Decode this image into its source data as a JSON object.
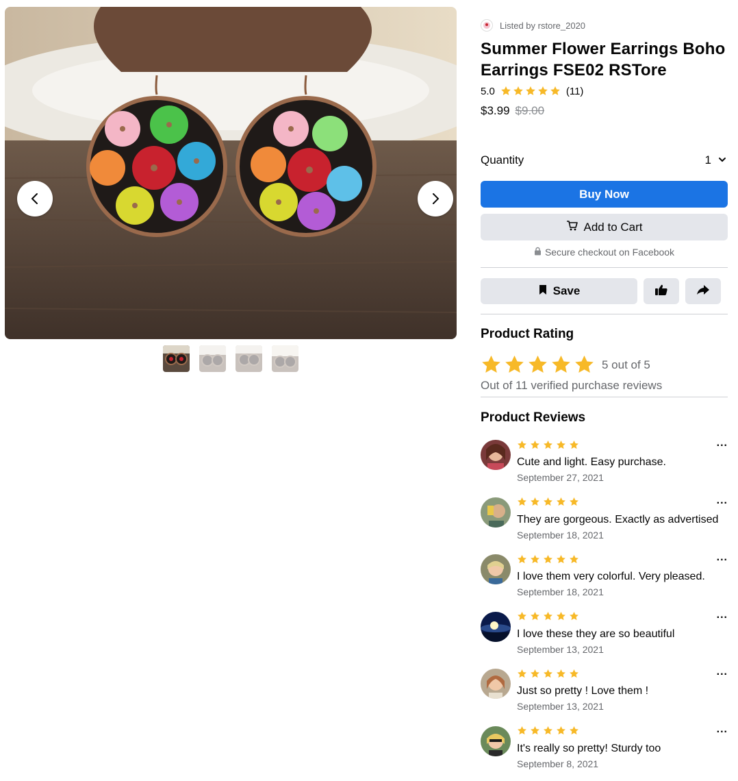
{
  "listing": {
    "seller_text": "Listed by rstore_2020",
    "title": "Summer Flower Earrings Boho Earrings FSE02 RSTore",
    "rating_value": "5.0",
    "rating_count": "(11)",
    "price": "$3.99",
    "original_price": "$9.00"
  },
  "purchase": {
    "quantity_label": "Quantity",
    "quantity_value": "1",
    "buy_label": "Buy Now",
    "cart_label": "Add to Cart",
    "secure_text": "Secure checkout on Facebook",
    "save_label": "Save"
  },
  "product_rating": {
    "heading": "Product Rating",
    "score_text": "5 out of 5",
    "verified_text": "Out of 11 verified purchase reviews",
    "stars": 5
  },
  "reviews_section": {
    "heading": "Product Reviews",
    "items": [
      {
        "text": "Cute and light. Easy purchase.",
        "date": "September 27, 2021",
        "stars": 5,
        "more": "..."
      },
      {
        "text": "They are gorgeous. Exactly as advertised",
        "date": "September 18, 2021",
        "stars": 5,
        "more": "..."
      },
      {
        "text": "I love them very colorful. Very pleased.",
        "date": "September 18, 2021",
        "stars": 5,
        "more": "..."
      },
      {
        "text": "I love these they are so beautiful",
        "date": "September 13, 2021",
        "stars": 5,
        "more": "..."
      },
      {
        "text": "Just so pretty ! Love them !",
        "date": "September 13, 2021",
        "stars": 5,
        "more": "..."
      },
      {
        "text": "It's really so pretty! Sturdy too",
        "date": "September 8, 2021",
        "stars": 5,
        "more": "..."
      }
    ]
  },
  "colors": {
    "accent_blue": "#1b74e4",
    "star_orange": "#f7b928",
    "button_gray": "#e4e6eb",
    "muted_text": "#65676b"
  },
  "icons": {
    "prev": "chevron-left-icon",
    "next": "chevron-right-icon",
    "cart": "cart-icon",
    "lock": "lock-icon",
    "save": "bookmark-icon",
    "like": "thumbs-up-icon",
    "share": "share-icon",
    "qty": "chevron-down-icon"
  }
}
